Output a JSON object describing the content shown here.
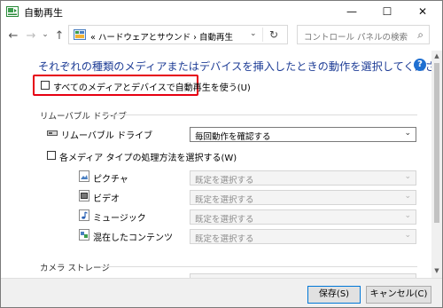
{
  "window": {
    "title": "自動再生",
    "controls": {
      "minimize": "—",
      "maximize": "☐",
      "close": "✕"
    }
  },
  "nav": {
    "back": "←",
    "forward": "→",
    "dropdown": "⌄",
    "up": "↑",
    "breadcrumb": "« ハードウェアとサウンド  ›  自動再生",
    "address_dropdown": "⌄",
    "refresh": "↻",
    "search_placeholder": "コントロール パネルの検索",
    "search_icon": "⌕"
  },
  "main": {
    "heading": "それぞれの種類のメディアまたはデバイスを挿入したときの動作を選択してください",
    "help": "?",
    "use_autoplay_label": "すべてのメディアとデバイスで自動再生を使う(U)",
    "use_autoplay_checked": false,
    "removable_section": "リムーバブル ドライブ",
    "removable_drive_label": "リムーバブル ドライブ",
    "removable_drive_value": "毎回動作を確認する",
    "per_media_label": "各メディア タイプの処理方法を選択する(W)",
    "per_media_checked": false,
    "media_types": [
      {
        "label": "ピクチャ",
        "value": "既定を選択する",
        "icon": "picture-icon"
      },
      {
        "label": "ビデオ",
        "value": "既定を選択する",
        "icon": "video-icon"
      },
      {
        "label": "ミュージック",
        "value": "既定を選択する",
        "icon": "music-icon"
      },
      {
        "label": "混在したコンテンツ",
        "value": "既定を選択する",
        "icon": "mixed-content-icon"
      }
    ],
    "camera_section": "カメラ ストレージ"
  },
  "footer": {
    "save": "保存(S)",
    "cancel": "キャンセル(C)"
  },
  "colors": {
    "heading": "#1e3d96",
    "highlight": "#e60012",
    "help": "#1f6fd1"
  }
}
